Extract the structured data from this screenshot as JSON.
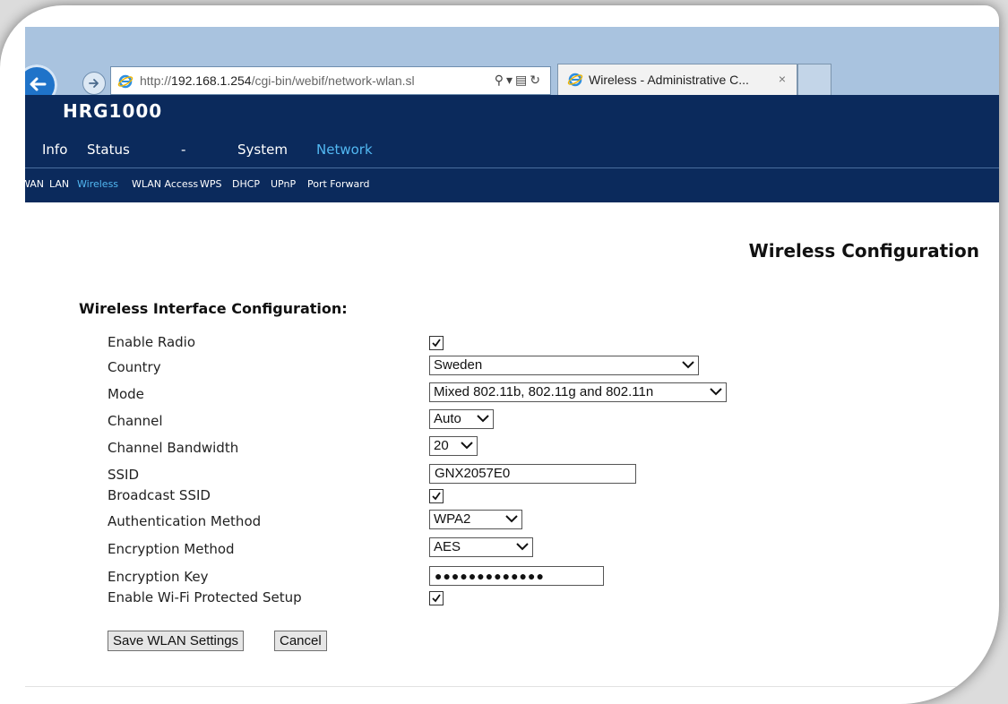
{
  "browser": {
    "address_url_base": "http://",
    "address_url_host": "192.168.1.254",
    "address_url_path": "/cgi-bin/webif/network-wlan.sl",
    "tab_title": "Wireless - Administrative C...",
    "tab_close": "×"
  },
  "router": {
    "brand": "HRG1000",
    "main_nav": [
      "Info",
      "Status",
      "-",
      "System",
      "Network"
    ],
    "main_nav_active": "Network",
    "sub_nav": [
      "WAN",
      "LAN",
      "Wireless",
      "WLAN Access",
      "WPS",
      "DHCP",
      "UPnP",
      "Port Forward"
    ],
    "sub_nav_active": "Wireless"
  },
  "page": {
    "title": "Wireless Configuration",
    "section_title": "Wireless Interface Configuration:"
  },
  "form": {
    "enable_radio": {
      "label": "Enable Radio",
      "checked": true
    },
    "country": {
      "label": "Country",
      "value": "Sweden"
    },
    "mode": {
      "label": "Mode",
      "value": "Mixed 802.11b, 802.11g and 802.11n"
    },
    "channel": {
      "label": "Channel",
      "value": "Auto"
    },
    "channel_bandwidth": {
      "label": "Channel Bandwidth",
      "value": "20"
    },
    "ssid": {
      "label": "SSID",
      "value": "GNX2057E0"
    },
    "broadcast_ssid": {
      "label": "Broadcast SSID",
      "checked": true
    },
    "authentication_method": {
      "label": "Authentication Method",
      "value": "WPA2"
    },
    "encryption_method": {
      "label": "Encryption Method",
      "value": "AES"
    },
    "encryption_key": {
      "label": "Encryption Key",
      "value": "●●●●●●●●●●●●●"
    },
    "enable_wps": {
      "label": "Enable Wi-Fi Protected Setup",
      "checked": true
    }
  },
  "buttons": {
    "save": "Save WLAN Settings",
    "cancel": "Cancel"
  },
  "colors": {
    "header_bg": "#0b2a5c",
    "active_link": "#52b8f2",
    "chrome_bg": "#a9c3df"
  }
}
